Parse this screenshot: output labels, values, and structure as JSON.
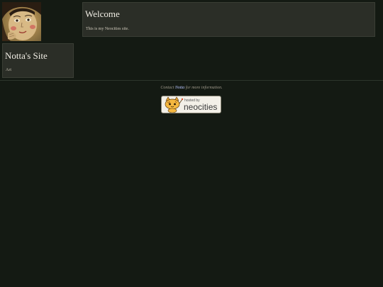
{
  "sidebar": {
    "site_title": "Notta's Site",
    "subtitle": "Art"
  },
  "main": {
    "heading": "Welcome",
    "intro": "This is my Neocities site."
  },
  "footer": {
    "contact_prefix": "Contact",
    "contact_link": "Notta",
    "contact_suffix": "for more information."
  },
  "badge": {
    "hosted_by": "hosted by",
    "name": "neocities"
  },
  "colors": {
    "background": "#141a13",
    "panel": "#2b2e27",
    "link": "#b9c6ff"
  },
  "icons": {
    "avatar": "painted-face-portrait",
    "badge": "neocities-cat-mascot"
  }
}
